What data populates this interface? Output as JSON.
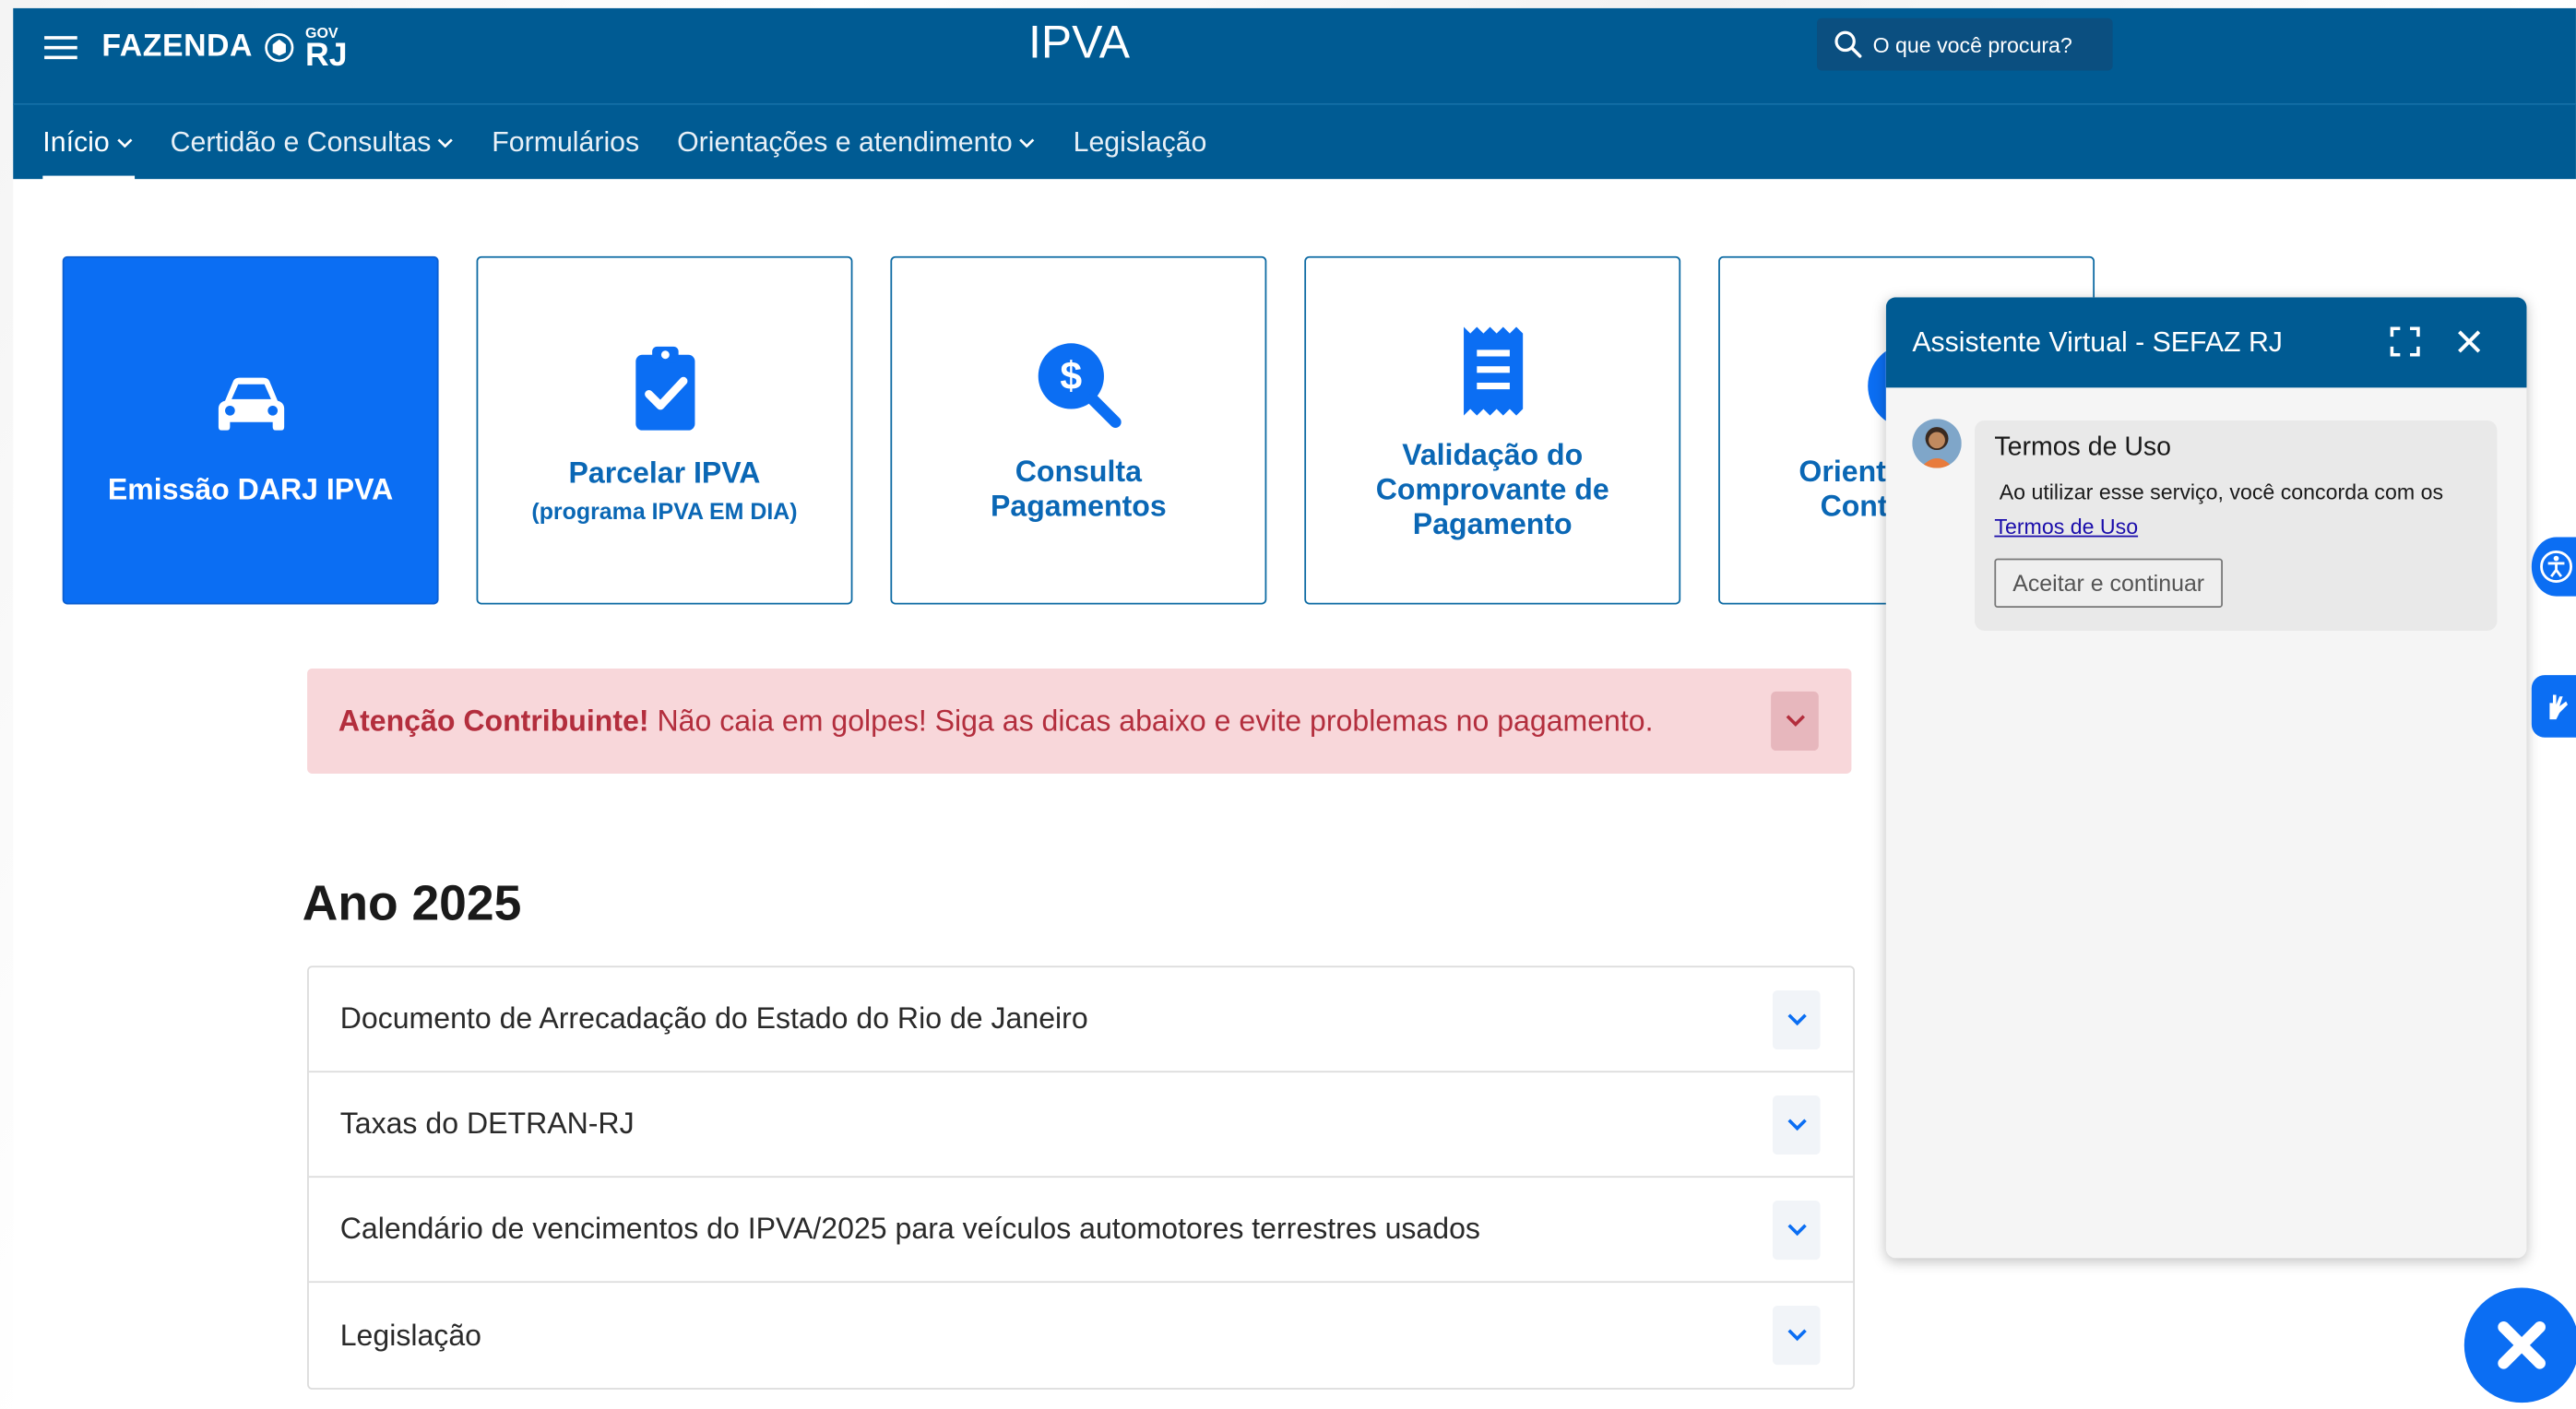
{
  "header": {
    "logo_text": "FAZENDA",
    "logo_gov": "GOV",
    "logo_rj": "RJ",
    "site_title": "IPVA",
    "search_placeholder": "O que você procura?"
  },
  "nav": {
    "items": [
      {
        "label": "Início",
        "has_caret": true,
        "active": true
      },
      {
        "label": "Certidão e Consultas",
        "has_caret": true
      },
      {
        "label": "Formulários",
        "has_caret": false
      },
      {
        "label": "Orientações e atendimento",
        "has_caret": true
      },
      {
        "label": "Legislação",
        "has_caret": false
      }
    ]
  },
  "cards": [
    {
      "title": "Emissão DARJ IPVA",
      "icon": "car-icon"
    },
    {
      "title": "Parcelar IPVA",
      "subtitle": "(programa IPVA EM DIA)",
      "icon": "clipboard-check-icon"
    },
    {
      "title_line1": "Consulta",
      "title_line2": "Pagamentos",
      "icon": "search-dollar-icon"
    },
    {
      "title_line1": "Validação do",
      "title_line2": "Comprovante de",
      "title_line3": "Pagamento",
      "icon": "receipt-icon"
    },
    {
      "title_line1": "Orient",
      "title_line2": "Cont",
      "icon": "info-circle-icon"
    }
  ],
  "alert": {
    "strong": "Atenção Contribuinte!",
    "text": "Não caia em golpes! Siga as dicas abaixo e evite problemas no pagamento."
  },
  "year_section": {
    "title": "Ano 2025",
    "items": [
      "Documento de Arrecadação do Estado do Rio de Janeiro",
      "Taxas do DETRAN-RJ",
      "Calendário de vencimentos do IPVA/2025 para veículos automotores terrestres usados",
      "Legislação"
    ]
  },
  "chat": {
    "title": "Assistente Virtual - SEFAZ RJ",
    "bubble_title": "Termos de Uso",
    "bubble_text": "Ao utilizar esse serviço, você concorda com os",
    "bubble_link": "Termos de Uso",
    "accept_label": "Aceitar e continuar"
  },
  "colors": {
    "header_bg": "#005b93",
    "primary": "#0b6ef3",
    "alert_bg": "#f8d7da",
    "alert_text": "#b32e3d"
  }
}
